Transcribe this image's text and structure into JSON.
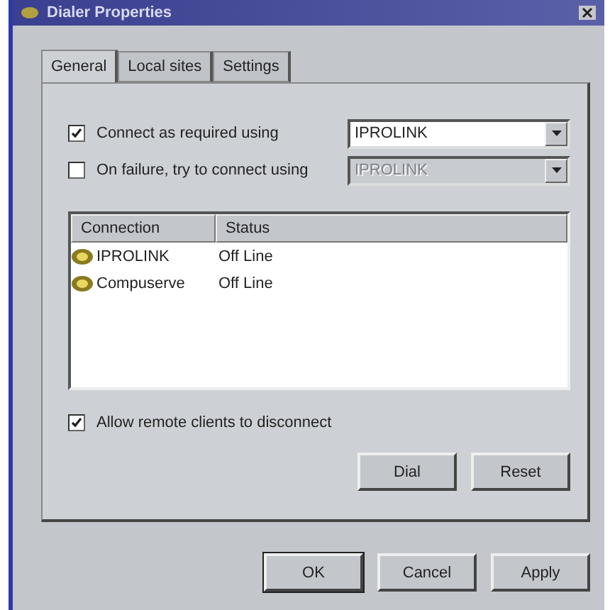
{
  "window": {
    "title": "Dialer Properties"
  },
  "tabs": [
    {
      "label": "General",
      "selected": true
    },
    {
      "label": "Local sites",
      "selected": false
    },
    {
      "label": "Settings",
      "selected": false
    }
  ],
  "connect_required": {
    "label": "Connect as required using",
    "checked": true,
    "dropdown": {
      "value": "IPROLINK",
      "disabled": false
    }
  },
  "on_failure": {
    "label": "On failure, try to connect using",
    "checked": false,
    "dropdown": {
      "value": "IPROLINK",
      "disabled": true
    }
  },
  "connections": {
    "columns": [
      "Connection",
      "Status"
    ],
    "rows": [
      {
        "name": "IPROLINK",
        "status": "Off Line"
      },
      {
        "name": "Compuserve",
        "status": "Off Line"
      }
    ]
  },
  "allow_disconnect": {
    "label": "Allow remote clients to disconnect",
    "checked": true
  },
  "panel_buttons": [
    "Dial",
    "Reset"
  ],
  "buttons": [
    {
      "label": "OK",
      "default": true
    },
    {
      "label": "Cancel",
      "default": false
    },
    {
      "label": "Apply",
      "default": false
    }
  ]
}
